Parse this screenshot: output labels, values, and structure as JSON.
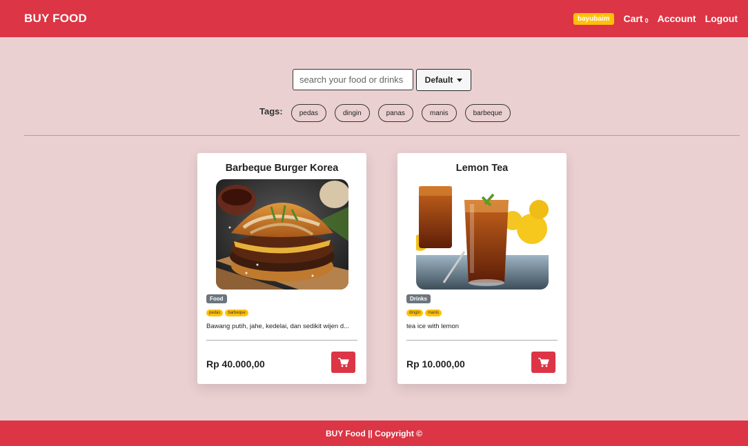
{
  "nav": {
    "brand": "BUY FOOD",
    "username": "bayubaim",
    "cart_label": "Cart",
    "cart_count": "0",
    "account_label": "Account",
    "logout_label": "Logout",
    "accent_color": "#dc3545"
  },
  "search": {
    "placeholder": "search your food or drinks",
    "value": "",
    "sort_label": "Default"
  },
  "tags": {
    "label": "Tags:",
    "items": [
      "pedas",
      "dingin",
      "panas",
      "manis",
      "barbeque"
    ]
  },
  "products": [
    {
      "title": "Barbeque Burger Korea",
      "image": "burger-photo",
      "category": "Food",
      "tags": [
        "pedas",
        "barbeque"
      ],
      "description": "Bawang putih, jahe, kedelai, dan sedikit wijen d...",
      "price": "Rp 40.000,00",
      "button_icon": "cart-icon"
    },
    {
      "title": "Lemon Tea",
      "image": "iced-tea-photo",
      "category": "Drinks",
      "tags": [
        "dingin",
        "manis"
      ],
      "description": "tea ice with lemon",
      "price": "Rp 10.000,00",
      "button_icon": "cart-icon"
    }
  ],
  "footer": {
    "text": "BUY Food || Copyright ©"
  }
}
